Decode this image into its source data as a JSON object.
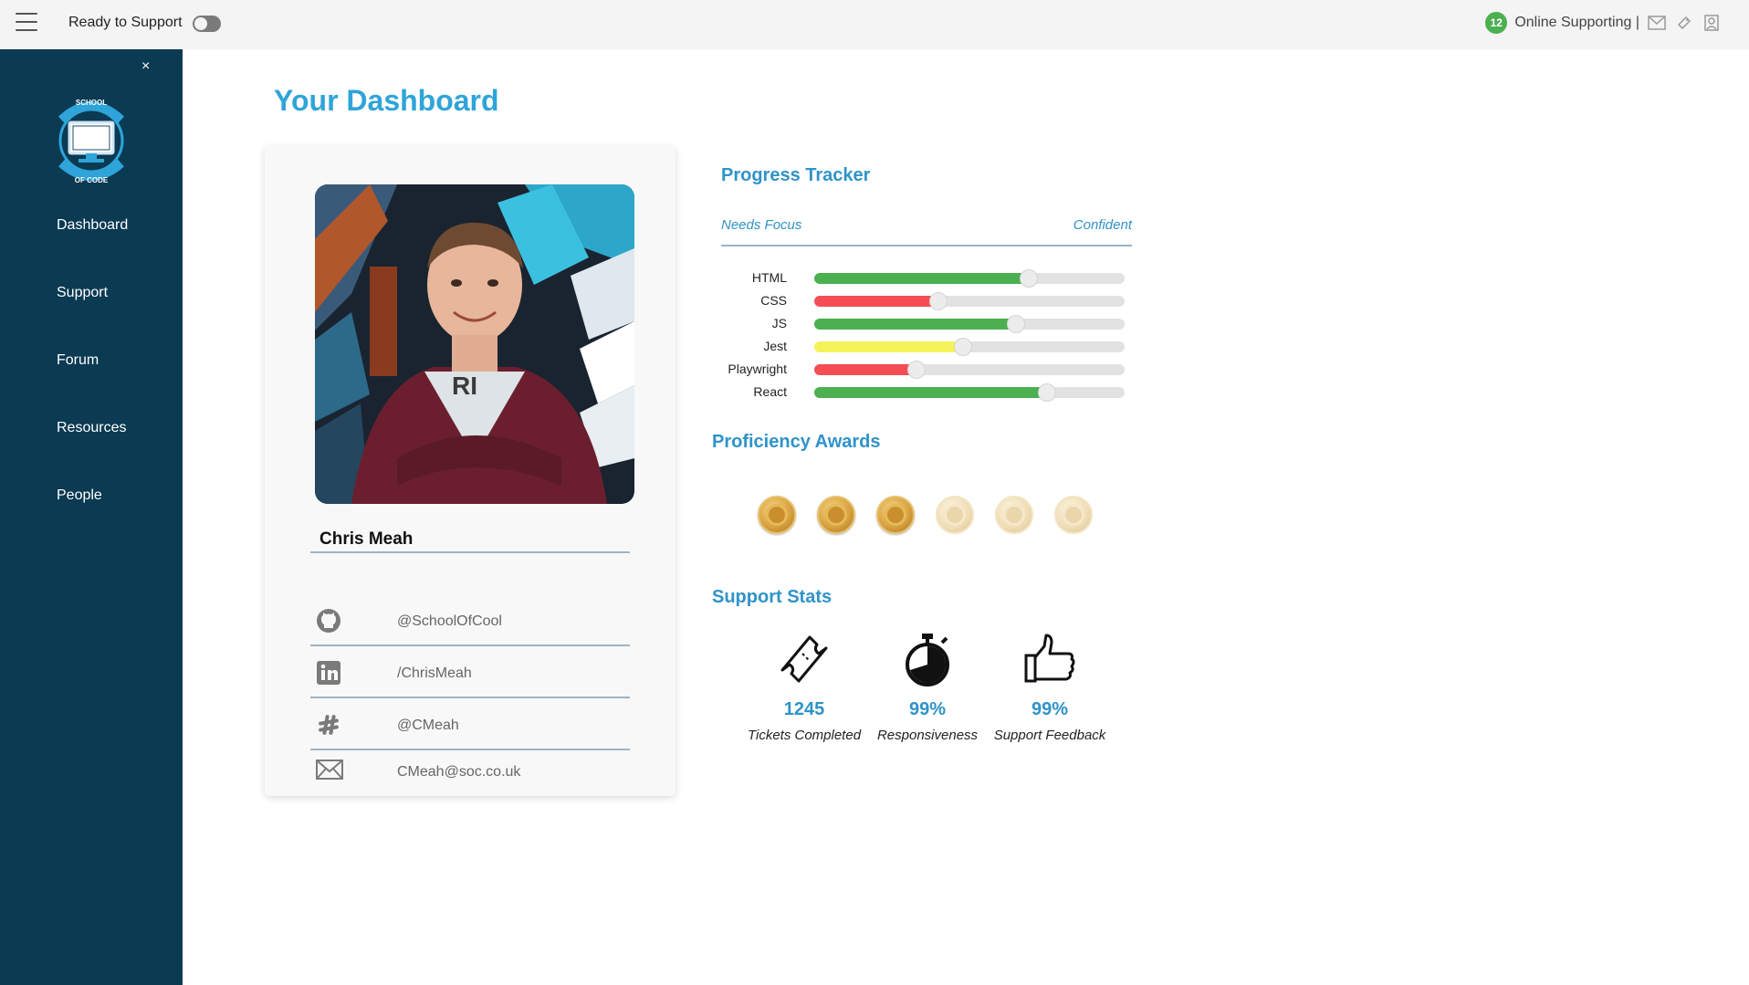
{
  "topbar": {
    "ready_label": "Ready to Support",
    "online_count": "12",
    "online_label": "Online Supporting |"
  },
  "sidebar": {
    "close": "×",
    "logo_text_top": "SCHOOL",
    "logo_text_bottom": "OF CODE",
    "items": [
      {
        "label": "Dashboard"
      },
      {
        "label": "Support"
      },
      {
        "label": "Forum"
      },
      {
        "label": "Resources"
      },
      {
        "label": "People"
      }
    ]
  },
  "main": {
    "title": "Your Dashboard",
    "profile": {
      "name": "Chris Meah",
      "contacts": [
        {
          "icon": "github-icon",
          "text": "@SchoolOfCool"
        },
        {
          "icon": "linkedin-icon",
          "text": "/ChrisMeah"
        },
        {
          "icon": "slack-icon",
          "text": "@CMeah"
        },
        {
          "icon": "email-icon",
          "text": "CMeah@soc.co.uk"
        }
      ]
    },
    "progress": {
      "title": "Progress Tracker",
      "low_label": "Needs Focus",
      "high_label": "Confident",
      "skills": [
        {
          "label": "HTML",
          "value": 0.69,
          "color": "#4caf50"
        },
        {
          "label": "CSS",
          "value": 0.4,
          "color": "#f44e54"
        },
        {
          "label": "JS",
          "value": 0.65,
          "color": "#4caf50"
        },
        {
          "label": "Jest",
          "value": 0.48,
          "color": "#f5f35a"
        },
        {
          "label": "Playwright",
          "value": 0.33,
          "color": "#f44e54"
        },
        {
          "label": "React",
          "value": 0.75,
          "color": "#4caf50"
        }
      ]
    },
    "awards": {
      "title": "Proficiency Awards",
      "earned": 3,
      "total": 6
    },
    "stats": {
      "title": "Support Stats",
      "items": [
        {
          "icon": "ticket-icon",
          "value": "1245",
          "label": "Tickets Completed"
        },
        {
          "icon": "stopwatch-icon",
          "value": "99%",
          "label": "Responsiveness"
        },
        {
          "icon": "thumbs-up-icon",
          "value": "99%",
          "label": "Support Feedback"
        }
      ]
    }
  },
  "colors": {
    "accent": "#2fa4d9",
    "sidebar": "#0b3a53",
    "online": "#4caf50"
  }
}
